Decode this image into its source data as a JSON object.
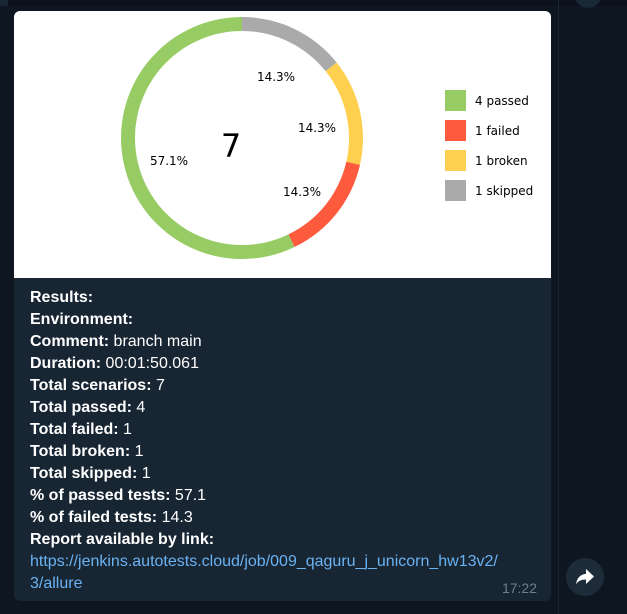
{
  "message": {
    "time": "17:22",
    "lines": [
      {
        "label": "Results:",
        "value": ""
      },
      {
        "label": "Environment:",
        "value": ""
      },
      {
        "label": "Comment:",
        "value": " branch main"
      },
      {
        "label": "Duration:",
        "value": " 00:01:50.061"
      },
      {
        "label": "Total scenarios:",
        "value": " 7"
      },
      {
        "label": "Total passed:",
        "value": " 4"
      },
      {
        "label": "Total failed:",
        "value": " 1"
      },
      {
        "label": "Total broken:",
        "value": " 1"
      },
      {
        "label": "Total skipped:",
        "value": " 1"
      },
      {
        "label": "% of passed tests:",
        "value": " 57.1"
      },
      {
        "label": "% of failed tests:",
        "value": " 14.3"
      },
      {
        "label": "Report available by link:",
        "value": ""
      }
    ],
    "link_line1": "https://jenkins.autotests.cloud/job/009_qaguru_j_unicorn_hw13v2/",
    "link_line2": "3/allure"
  },
  "forward_icon": "forward-arrow-icon",
  "chart_data": {
    "type": "pie",
    "center_label": "7",
    "slices": [
      {
        "label": "4 passed",
        "value": 4,
        "percent_label": "57.1%",
        "color": "#97cc64"
      },
      {
        "label": "1 failed",
        "value": 1,
        "percent_label": "14.3%",
        "color": "#fd5a3e"
      },
      {
        "label": "1 broken",
        "value": 1,
        "percent_label": "14.3%",
        "color": "#ffd050"
      },
      {
        "label": "1 skipped",
        "value": 1,
        "percent_label": "14.3%",
        "color": "#aaaaaa"
      }
    ],
    "legend_position": "right"
  }
}
